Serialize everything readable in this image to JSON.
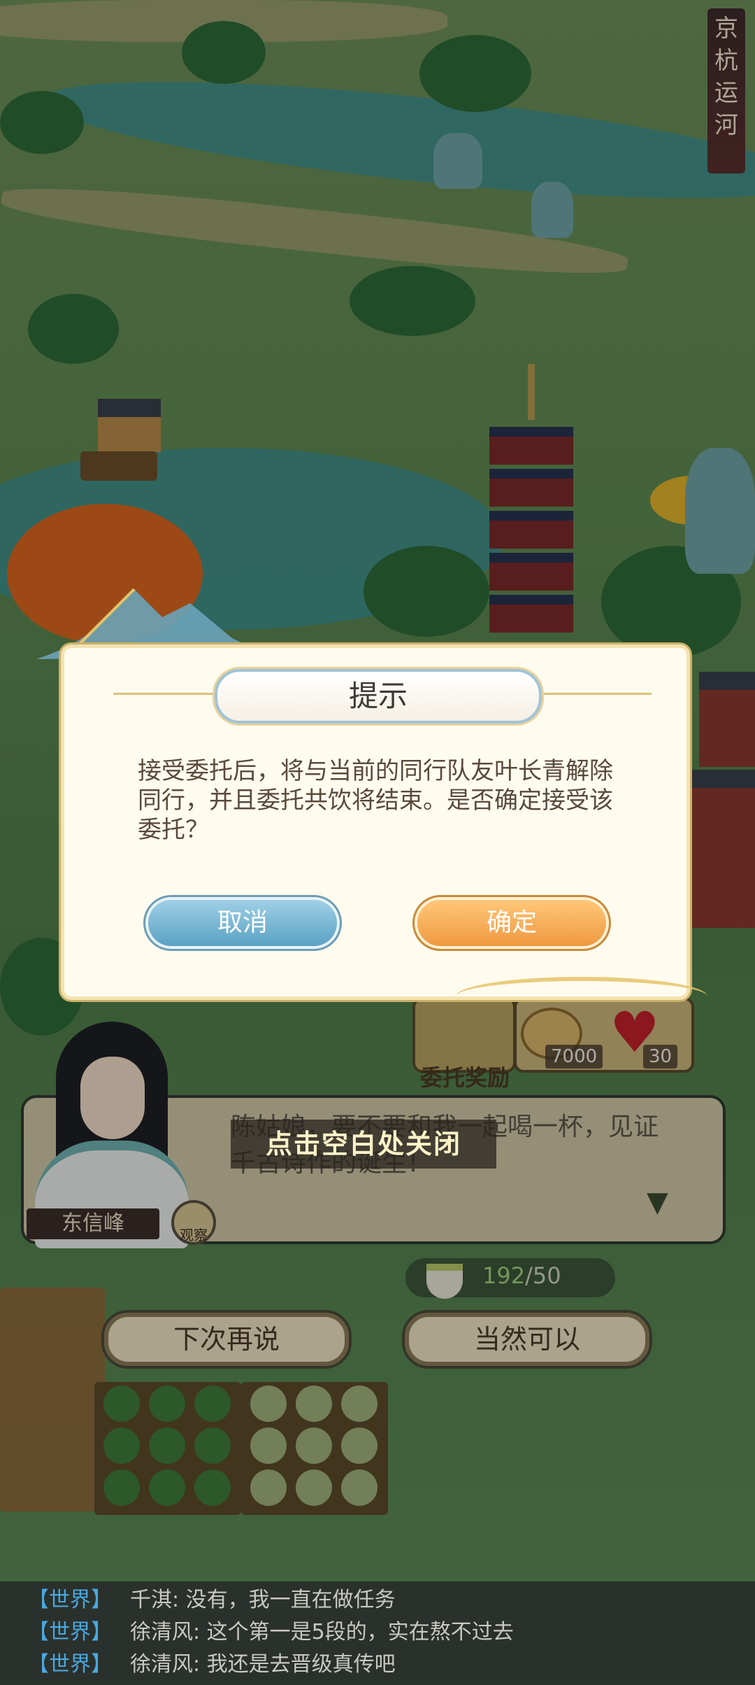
{
  "location_title": "京杭运河",
  "dialog": {
    "title": "提示",
    "message": "接受委托后，将与当前的同行队友叶长青解除同行，并且委托共饮将结束。是否确定接受该委托？",
    "cancel_label": "取消",
    "confirm_label": "确定"
  },
  "npc": {
    "name": "东信峰",
    "observe_label": "观察",
    "dialogue": "陈姑娘，要不要和我一起喝一杯，见证千古诗作的诞生！",
    "close_hint": "点击空白处关闭"
  },
  "reward": {
    "label": "委托奖励",
    "coins": "7000",
    "hearts": "30"
  },
  "stamina": {
    "current": "192",
    "max": "/50"
  },
  "choices": {
    "later": "下次再说",
    "accept": "当然可以"
  },
  "chat": [
    {
      "channel": "【世界】",
      "text": "千淇: 没有，我一直在做任务"
    },
    {
      "channel": "【世界】",
      "text": "徐清风: 这个第一是5段的，实在熬不过去"
    },
    {
      "channel": "【世界】",
      "text": "徐清风: 我还是去晋级真传吧"
    }
  ],
  "colors": {
    "cancel_button": "#5aa1c4",
    "confirm_button": "#ef9840",
    "chat_channel": "#4aa7de",
    "stamina_value": "#9fcf80"
  }
}
